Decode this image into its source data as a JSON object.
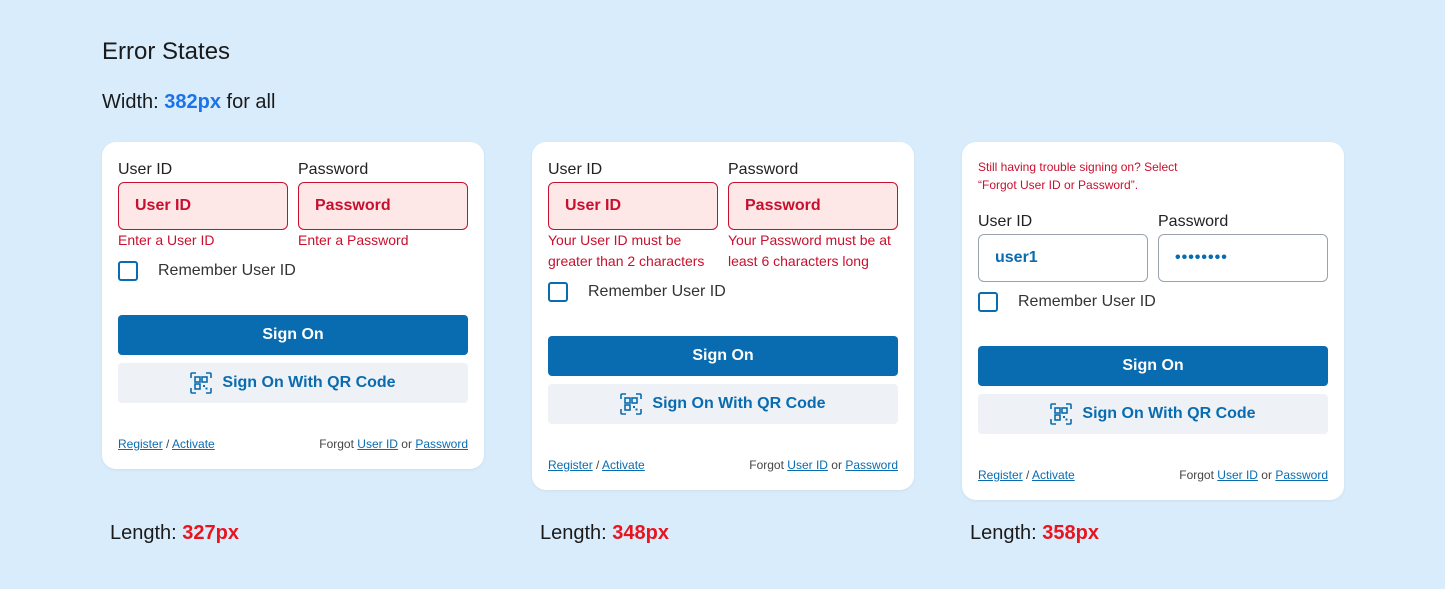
{
  "page": {
    "title": "Error States",
    "width_label": "Width: ",
    "width_value": "382px",
    "width_suffix": " for all",
    "length_label": "Length: "
  },
  "colors": {
    "background": "#d9ecfb",
    "primary": "#0a6cb0",
    "error": "#c8102e",
    "highlight_blue": "#1a73e8",
    "highlight_red": "#e8141e"
  },
  "cards": [
    {
      "userid_label": "User ID",
      "password_label": "Password",
      "userid_value": "User ID",
      "password_value": "Password",
      "userid_error": "Enter a User ID",
      "password_error": "Enter a Password",
      "remember_label": "Remember User ID",
      "sign_on": "Sign On",
      "qr_label": "Sign On With QR Code",
      "register": "Register",
      "separator": "/",
      "activate": "Activate",
      "forgot": "Forgot",
      "forgot_userid": "User ID",
      "or": "or",
      "forgot_password": "Password",
      "length": "327px"
    },
    {
      "userid_label": "User ID",
      "password_label": "Password",
      "userid_value": "User ID",
      "password_value": "Password",
      "userid_error": "Your User ID must be greater than 2 characters",
      "password_error": "Your Password must be at least 6 characters long",
      "remember_label": "Remember User ID",
      "sign_on": "Sign On",
      "qr_label": "Sign On With QR Code",
      "register": "Register",
      "separator": "/",
      "activate": "Activate",
      "forgot": "Forgot",
      "forgot_userid": "User ID",
      "or": "or",
      "forgot_password": "Password",
      "length": "348px"
    },
    {
      "trouble_message": "Still having trouble signing on? Select “Forgot User ID or Password”.",
      "userid_label": "User ID",
      "password_label": "Password",
      "userid_value": "user1",
      "password_value": "••••••••",
      "remember_label": "Remember User ID",
      "sign_on": "Sign On",
      "qr_label": "Sign On With QR Code",
      "register": "Register",
      "separator": "/",
      "activate": "Activate",
      "forgot": "Forgot",
      "forgot_userid": "User ID",
      "or": "or",
      "forgot_password": "Password",
      "length": "358px"
    }
  ],
  "icons": {
    "qr": "qr-code-icon"
  }
}
